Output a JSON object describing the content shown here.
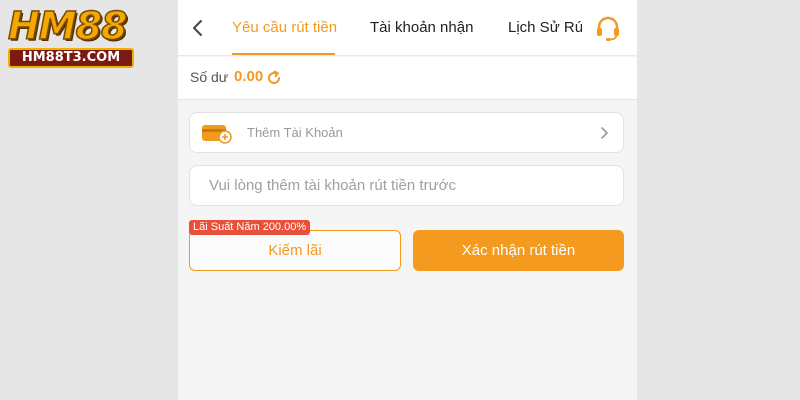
{
  "logo": {
    "main_text": "HM88",
    "sub_text": "HM88T3.COM"
  },
  "header": {
    "back_icon": "chevron-left-icon",
    "tabs": [
      {
        "label": "Yêu cầu rút tiền",
        "active": true
      },
      {
        "label": "Tài khoản nhận",
        "active": false
      },
      {
        "label": "Lịch Sử Rú",
        "active": false
      }
    ],
    "support_icon": "headset-icon"
  },
  "balance": {
    "label": "Số dư",
    "value": "0.00",
    "refresh_icon": "refresh-icon"
  },
  "add_account": {
    "icon": "wallet-add-icon",
    "label": "Thêm Tài Khoản",
    "chevron_icon": "chevron-right-icon"
  },
  "account_input": {
    "value": "",
    "placeholder": "Vui lòng thêm tài khoản rút tiền trước"
  },
  "actions": {
    "interest_badge": "Lãi Suất Năm 200.00%",
    "earn_label": "Kiếm lãi",
    "confirm_label": "Xác nhận rút tiền"
  },
  "colors": {
    "accent": "#f39a1f",
    "badge": "#e8503a",
    "background": "#e6e6e6",
    "panel": "#f5f5f5"
  }
}
